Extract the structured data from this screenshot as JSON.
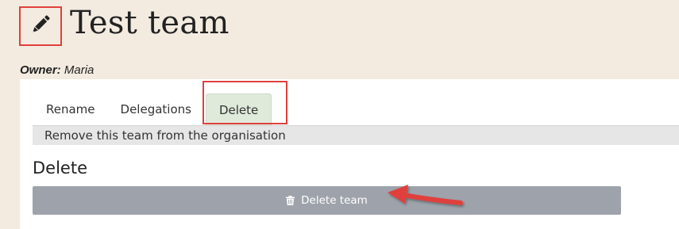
{
  "header": {
    "title": "Test team",
    "edit_icon": "pencil-icon"
  },
  "owner": {
    "label": "Owner:",
    "name": "Maria"
  },
  "tabs": [
    {
      "label": "Rename",
      "active": false
    },
    {
      "label": "Delegations",
      "active": false
    },
    {
      "label": "Delete",
      "active": true
    }
  ],
  "tab_description": "Remove this team from the organisation",
  "section": {
    "heading": "Delete",
    "button_label": "Delete team",
    "button_icon": "trash-icon"
  },
  "colors": {
    "page_bg": "#f3ebe0",
    "active_tab_bg": "#dfeadb",
    "button_bg": "#9ea3ab",
    "annotation_red": "#e0403c"
  }
}
